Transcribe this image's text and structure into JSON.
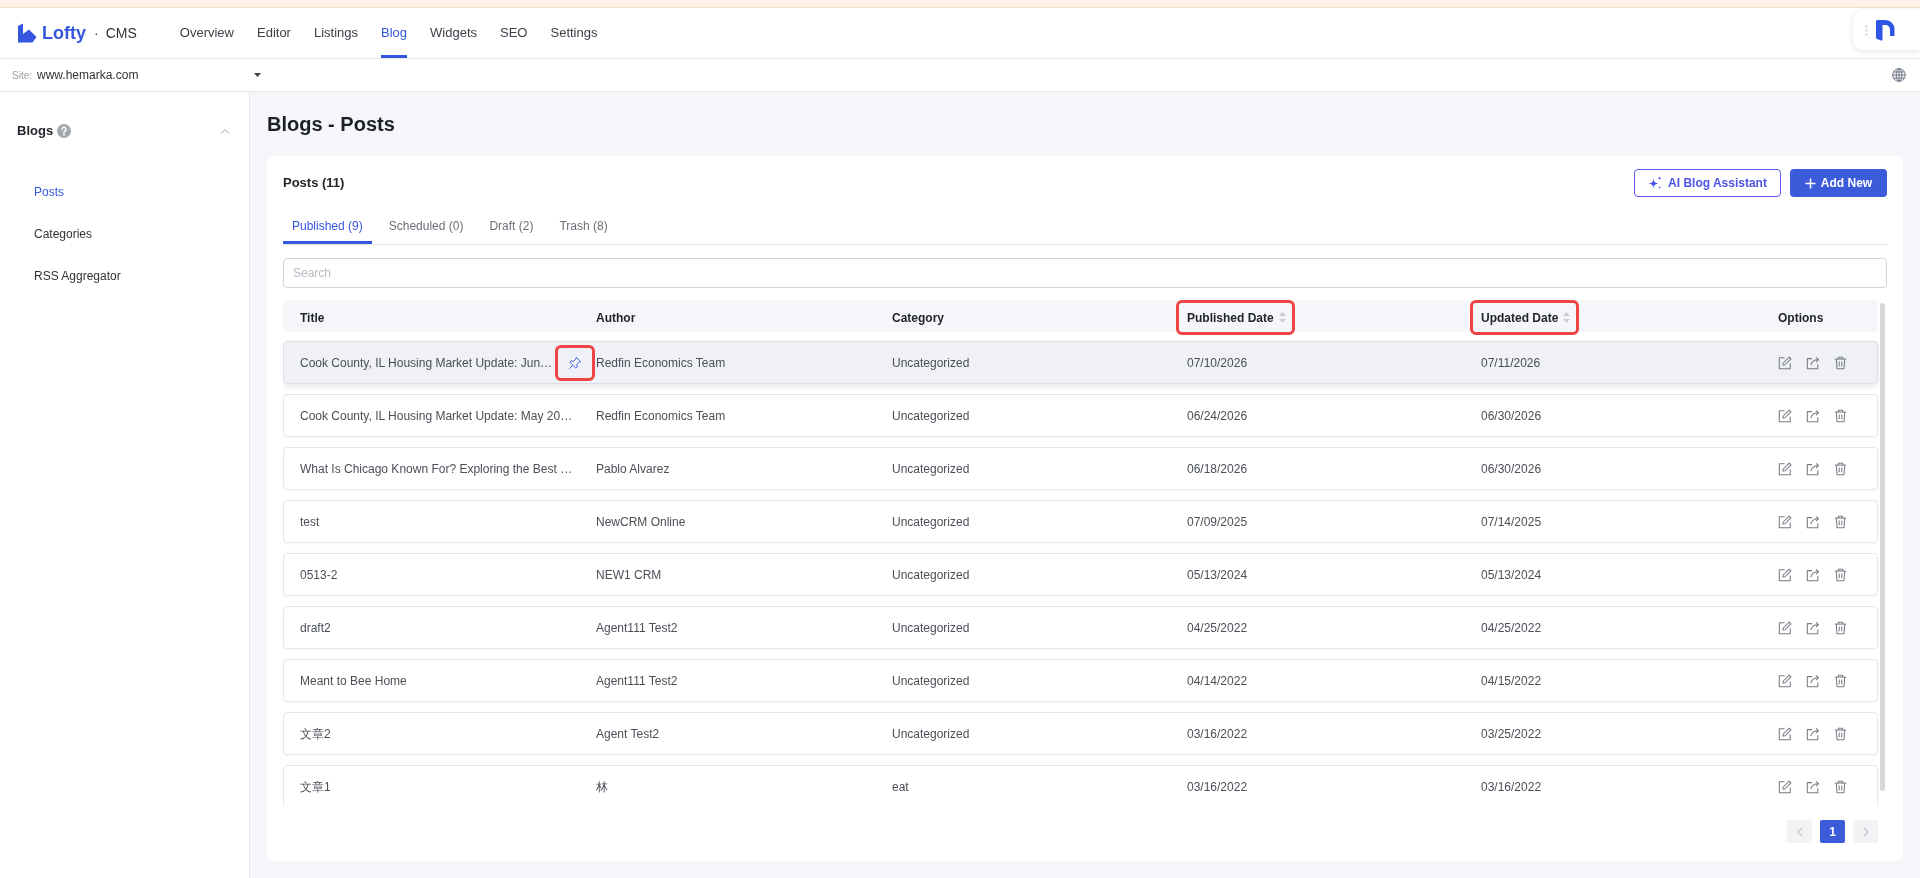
{
  "top_bar": {
    "logo": {
      "brand": "Lofty",
      "separator": "·",
      "product": "CMS"
    },
    "nav": [
      {
        "label": "Overview",
        "selected": false
      },
      {
        "label": "Editor",
        "selected": false
      },
      {
        "label": "Listings",
        "selected": false
      },
      {
        "label": "Blog",
        "selected": true
      },
      {
        "label": "Widgets",
        "selected": false
      },
      {
        "label": "SEO",
        "selected": false
      },
      {
        "label": "Settings",
        "selected": false
      }
    ]
  },
  "site_bar": {
    "label": "Site:",
    "value": "www.hemarka.com"
  },
  "sidebar": {
    "group": {
      "label": "Blogs",
      "expanded": true
    },
    "items": [
      {
        "label": "Posts",
        "selected": true
      },
      {
        "label": "Categories",
        "selected": false
      },
      {
        "label": "RSS Aggregator",
        "selected": false
      }
    ]
  },
  "page": {
    "title": "Blogs - Posts"
  },
  "posts_card": {
    "heading": "Posts (11)",
    "buttons": [
      {
        "kind": "assistant",
        "label": "AI Blog Assistant"
      },
      {
        "kind": "primary",
        "label": "Add New"
      }
    ],
    "tabs": [
      {
        "label": "Published (9)",
        "selected": true
      },
      {
        "label": "Scheduled (0)",
        "selected": false
      },
      {
        "label": "Draft (2)",
        "selected": false
      },
      {
        "label": "Trash (8)",
        "selected": false
      }
    ],
    "search": {
      "placeholder": "Search"
    },
    "table": {
      "columns": [
        {
          "label": "Title",
          "sortable": false,
          "highlighted": false
        },
        {
          "label": "Author",
          "sortable": false,
          "highlighted": false
        },
        {
          "label": "Category",
          "sortable": false,
          "highlighted": false
        },
        {
          "label": "Published Date",
          "sortable": true,
          "highlighted": true
        },
        {
          "label": "Updated Date",
          "sortable": true,
          "highlighted": true
        },
        {
          "label": "Options",
          "sortable": false,
          "highlighted": false
        }
      ],
      "rows": [
        {
          "title": "Cook County, IL Housing Market Update: Jun…",
          "author": "Redfin Economics Team",
          "category": "Uncategorized",
          "published_date": "07/10/2026",
          "updated_date": "07/11/2026",
          "pinned": true,
          "pin_highlighted": true,
          "hovered": true
        },
        {
          "title": "Cook County, IL Housing Market Update: May 20…",
          "author": "Redfin Economics Team",
          "category": "Uncategorized",
          "published_date": "06/24/2026",
          "updated_date": "06/30/2026",
          "pinned": false,
          "hovered": false
        },
        {
          "title": "What Is Chicago Known For? Exploring the Best …",
          "author": "Pablo Alvarez",
          "category": "Uncategorized",
          "published_date": "06/18/2026",
          "updated_date": "06/30/2026",
          "pinned": false,
          "hovered": false
        },
        {
          "title": "test",
          "author": "NewCRM Online",
          "category": "Uncategorized",
          "published_date": "07/09/2025",
          "updated_date": "07/14/2025",
          "pinned": false,
          "hovered": false
        },
        {
          "title": "0513-2",
          "author": "NEW1 CRM",
          "category": "Uncategorized",
          "published_date": "05/13/2024",
          "updated_date": "05/13/2024",
          "pinned": false,
          "hovered": false
        },
        {
          "title": "draft2",
          "author": "Agent111 Test2",
          "category": "Uncategorized",
          "published_date": "04/25/2022",
          "updated_date": "04/25/2022",
          "pinned": false,
          "hovered": false
        },
        {
          "title": "Meant to Bee Home",
          "author": "Agent111 Test2",
          "category": "Uncategorized",
          "published_date": "04/14/2022",
          "updated_date": "04/15/2022",
          "pinned": false,
          "hovered": false
        },
        {
          "title": "文章2",
          "author": "Agent Test2",
          "category": "Uncategorized",
          "published_date": "03/16/2022",
          "updated_date": "03/25/2022",
          "pinned": false,
          "hovered": false
        },
        {
          "title": "文章1",
          "author": "林",
          "category": "eat",
          "published_date": "03/16/2022",
          "updated_date": "03/16/2022",
          "pinned": false,
          "hovered": false
        }
      ]
    },
    "pagination": {
      "previous_disabled": true,
      "pages": [
        {
          "label": "1",
          "selected": true
        }
      ],
      "next_disabled": true
    }
  }
}
